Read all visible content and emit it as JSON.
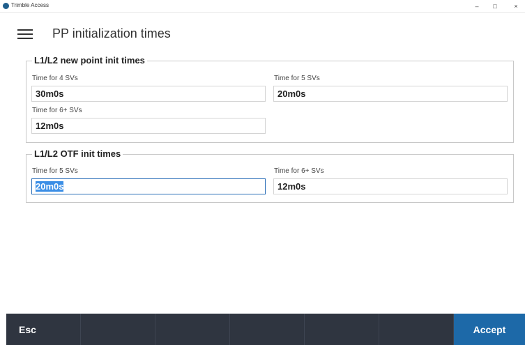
{
  "window": {
    "title": "Trimble Access",
    "minimize_glyph": "–",
    "maximize_glyph": "□",
    "close_glyph": "×"
  },
  "header": {
    "title": "PP initialization times",
    "menu_icon": "hamburger-menu-icon"
  },
  "groups": [
    {
      "legend": "L1/L2 new point init times",
      "fields": [
        {
          "label": "Time for 4 SVs",
          "value": "30m0s"
        },
        {
          "label": "Time for 5 SVs",
          "value": "20m0s"
        },
        {
          "label": "Time for 6+ SVs",
          "value": "12m0s"
        }
      ]
    },
    {
      "legend": "L1/L2 OTF init times",
      "fields": [
        {
          "label": "Time for 5 SVs",
          "value": "20m0s",
          "focused": true
        },
        {
          "label": "Time for 6+ SVs",
          "value": "12m0s"
        }
      ]
    }
  ],
  "softkeys": [
    {
      "label": "Esc"
    },
    {
      "label": ""
    },
    {
      "label": ""
    },
    {
      "label": ""
    },
    {
      "label": ""
    },
    {
      "label": ""
    },
    {
      "label": "Accept"
    }
  ],
  "colors": {
    "accent": "#1d69a8",
    "bottombar": "#2f3540",
    "selection": "#3a8ee6"
  }
}
